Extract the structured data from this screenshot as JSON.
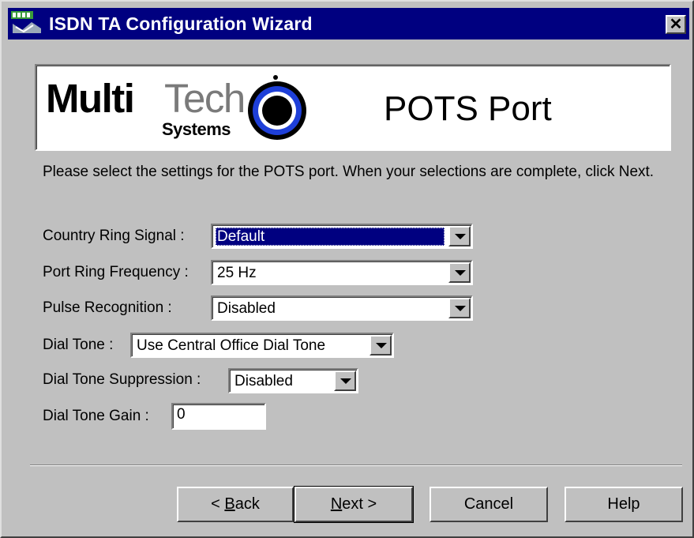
{
  "window": {
    "title": "ISDN TA Configuration Wizard",
    "close_glyph": "✕"
  },
  "banner": {
    "logo_word_bold": "Multi",
    "logo_word_light": "Tech",
    "logo_sub": "Systems",
    "heading": "POTS Port"
  },
  "instructions": "Please select the settings for the POTS port.  When your selections are complete, click Next.",
  "fields": {
    "country_ring_signal": {
      "label": "Country Ring Signal :",
      "value": "Default"
    },
    "port_ring_frequency": {
      "label": "Port Ring Frequency :",
      "value": "25 Hz"
    },
    "pulse_recognition": {
      "label": "Pulse Recognition :",
      "value": "Disabled"
    },
    "dial_tone": {
      "label": "Dial Tone :",
      "value": "Use Central Office Dial Tone"
    },
    "dial_tone_suppression": {
      "label": "Dial Tone Suppression :",
      "value": "Disabled"
    },
    "dial_tone_gain": {
      "label": "Dial Tone Gain :",
      "value": "0"
    }
  },
  "buttons": {
    "back": {
      "prefix": "< ",
      "mnemonic": "B",
      "rest": "ack"
    },
    "next": {
      "mnemonic": "N",
      "rest": "ext >"
    },
    "cancel": "Cancel",
    "help": "Help"
  },
  "colors": {
    "titlebar": "#000080",
    "face": "#c0c0c0",
    "logo_blue": "#1e3fd8"
  },
  "icons": {
    "app": "multitech-app-icon",
    "dropdown": "chevron-down-icon",
    "close": "close-icon"
  }
}
